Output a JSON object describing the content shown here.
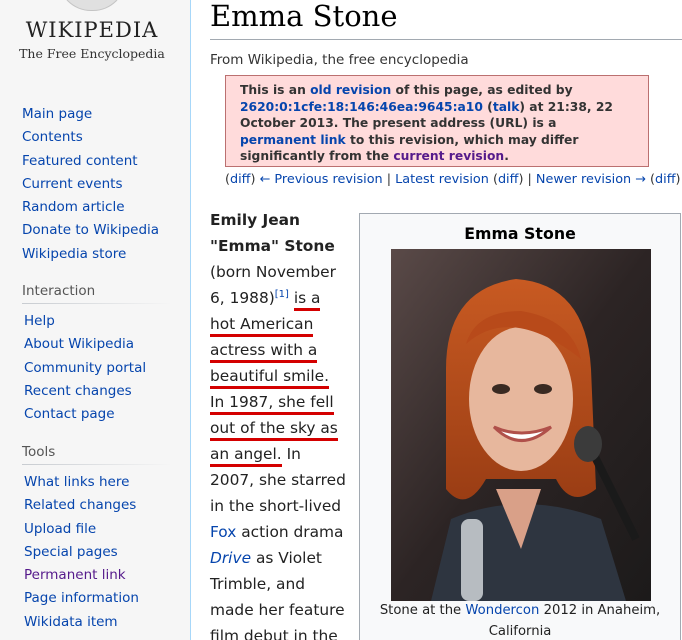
{
  "logo": {
    "wordmark": "WIKIPEDIA",
    "tagline": "The Free Encyclopedia"
  },
  "nav_main": [
    "Main page",
    "Contents",
    "Featured content",
    "Current events",
    "Random article",
    "Donate to Wikipedia",
    "Wikipedia store"
  ],
  "interaction": {
    "heading": "Interaction",
    "items": [
      "Help",
      "About Wikipedia",
      "Community portal",
      "Recent changes",
      "Contact page"
    ]
  },
  "tools": {
    "heading": "Tools",
    "items": [
      "What links here",
      "Related changes",
      "Upload file",
      "Special pages",
      "Permanent link",
      "Page information",
      "Wikidata item"
    ]
  },
  "article": {
    "title": "Emma Stone",
    "tagline": "From Wikipedia, the free encyclopedia",
    "notice": {
      "t1": "This is an ",
      "old_revision": "old revision",
      "t2": " of this page, as edited by ",
      "user": "2620:0:1cfe:18:146:46ea:9645:a10",
      "t3": " (",
      "talk": "talk",
      "t4": ") at 21:38, 22 October 2013. The present address (URL) is a ",
      "permanent_link": "permanent link",
      "t5": " to this revision, which may differ significantly from the ",
      "current_revision": "current revision",
      "t6": "."
    },
    "revnav": {
      "p1": "(",
      "diff1": "diff",
      "p2": ") ",
      "prev": "← Previous revision",
      "sep1": " | ",
      "latest": "Latest revision",
      "p3": " (",
      "diff2": "diff",
      "p4": ") | ",
      "newer": "Newer revision →",
      "p5": " (",
      "diff3": "diff",
      "p6": ")"
    },
    "lead": {
      "name": "Emily Jean \"Emma\" Stone",
      "born": " (born November 6, 1988)",
      "cite": "[1]",
      "underlined": "is a hot American actress with a beautiful smile. In 1987, she fell out of the sky as an angel.",
      "t1": " In 2007, she starred in the short-lived ",
      "fox": "Fox",
      "t2": " action drama ",
      "drive": "Drive",
      "t3": " as Violet Trimble, and made her feature film debut in the"
    },
    "infobox": {
      "title": "Emma Stone",
      "caption_pre": "Stone at the ",
      "caption_link": "Wondercon",
      "caption_post": " 2012 in Anaheim, California"
    }
  },
  "colors": {
    "link": "#0645ad",
    "visited": "#551a8b",
    "notice_bg": "#ffdbdb",
    "notice_border": "#bb7070",
    "underline": "#d40000"
  }
}
